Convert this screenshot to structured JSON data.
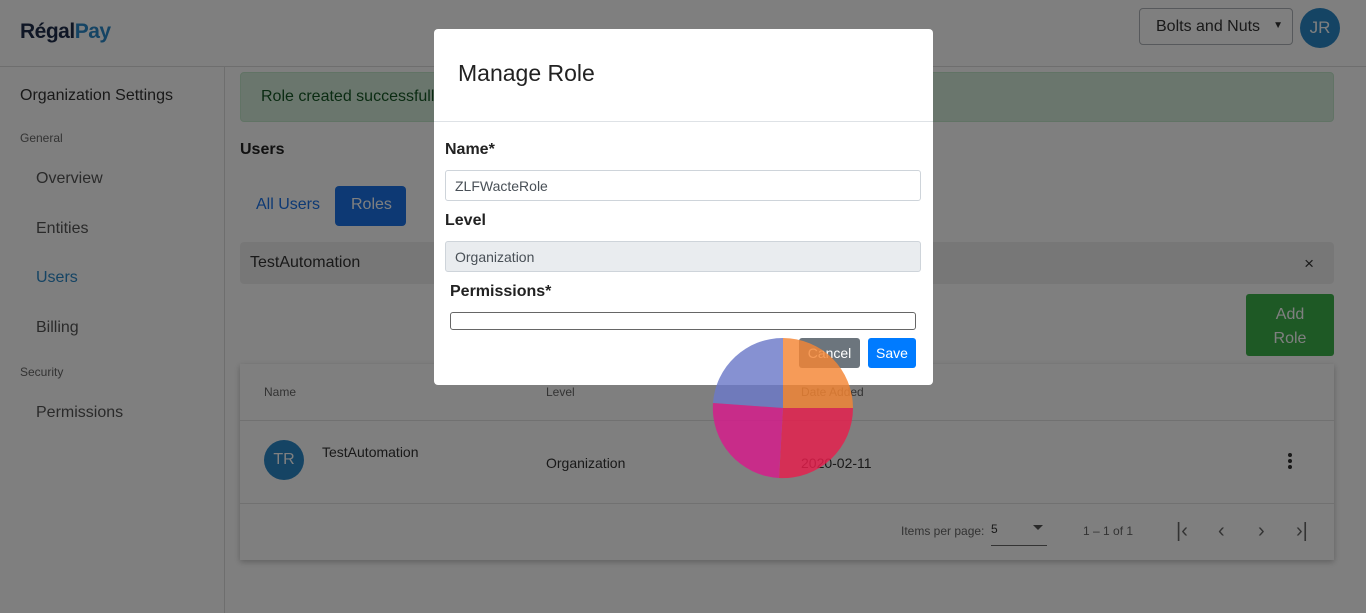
{
  "header": {
    "logo_regal": "Régal",
    "logo_pay": "Pay",
    "org_selected": "Bolts and Nuts",
    "user_initials": "JR"
  },
  "sidebar": {
    "title": "Organization Settings",
    "section_general": "General",
    "items": [
      {
        "label": "Overview"
      },
      {
        "label": "Entities"
      },
      {
        "label": "Users"
      },
      {
        "label": "Billing"
      }
    ],
    "section_security": "Security",
    "security_items": [
      {
        "label": "Permissions"
      }
    ]
  },
  "main": {
    "alert": "Role created successfully",
    "heading": "Users",
    "tabs": [
      {
        "label": "All Users"
      },
      {
        "label": "Roles"
      }
    ],
    "role_row": {
      "name": "TestAutomation",
      "close": "×"
    },
    "add_role_line1": "Add",
    "add_role_line2": "Role",
    "table": {
      "headers": [
        "Name",
        "Level",
        "Date Added"
      ],
      "rows": [
        {
          "initials": "TR",
          "name": "TestAutomation",
          "level": "Organization",
          "date": "2020-02-11"
        }
      ]
    },
    "paginator": {
      "items_per_page_label": "Items per page:",
      "items_per_page": "5",
      "range": "1 – 1 of 1"
    }
  },
  "modal": {
    "title": "Manage Role",
    "name_label": "Name*",
    "name_value": "ZLFWacteRole",
    "level_label": "Level",
    "level_value": "Organization",
    "permissions_label": "Permissions*",
    "cancel_label": "Cancel",
    "save_label": "Save"
  },
  "colors": {
    "accent": "#1a73e8",
    "success": "#3cb34b",
    "avatar": "#2b88c8",
    "spinner": [
      "#6c7ac9",
      "#f58634",
      "#e91e4d",
      "#d81b8c"
    ]
  }
}
